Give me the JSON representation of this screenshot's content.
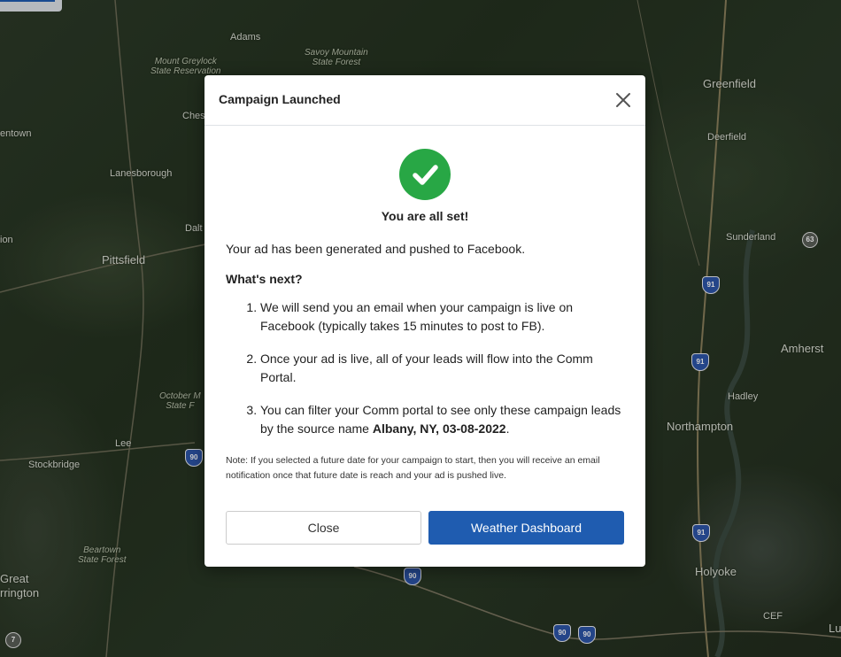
{
  "map": {
    "places": [
      {
        "id": "adams",
        "label": "Adams"
      },
      {
        "id": "mt-greylock",
        "label": "Mount Greylock\nState Reservation"
      },
      {
        "id": "savoy",
        "label": "Savoy Mountain\nState Forest"
      },
      {
        "id": "greenfield",
        "label": "Greenfield"
      },
      {
        "id": "entown",
        "label": "entown"
      },
      {
        "id": "ches",
        "label": "Ches"
      },
      {
        "id": "deerfield",
        "label": "Deerfield"
      },
      {
        "id": "lanesborough",
        "label": "Lanesborough"
      },
      {
        "id": "dalt",
        "label": "Dalt"
      },
      {
        "id": "sunderland",
        "label": "Sunderland"
      },
      {
        "id": "ion",
        "label": "ion"
      },
      {
        "id": "pittsfield",
        "label": "Pittsfield"
      },
      {
        "id": "amherst",
        "label": "Amherst"
      },
      {
        "id": "october",
        "label": "October M\nState F"
      },
      {
        "id": "hadley",
        "label": "Hadley"
      },
      {
        "id": "northampton",
        "label": "Northampton"
      },
      {
        "id": "lee",
        "label": "Lee"
      },
      {
        "id": "stockbridge",
        "label": "Stockbridge"
      },
      {
        "id": "beartown",
        "label": "Beartown\nState Forest"
      },
      {
        "id": "holyoke",
        "label": "Holyoke"
      },
      {
        "id": "great",
        "label": "Great"
      },
      {
        "id": "barrington",
        "label": "rrington"
      },
      {
        "id": "cef",
        "label": "CEF"
      },
      {
        "id": "lu",
        "label": "Lu"
      }
    ],
    "shields": [
      "91",
      "91",
      "91",
      "90",
      "90",
      "90",
      "90"
    ],
    "routes": [
      "63",
      "7"
    ]
  },
  "modal": {
    "title": "Campaign Launched",
    "success_heading": "You are all set!",
    "intro": "Your ad has been generated and pushed to Facebook.",
    "next_heading": "What's next?",
    "steps": [
      "We will send you an email when your campaign is live on Facebook (typically takes 15 minutes to post to FB).",
      "Once your ad is live, all of your leads will flow into the Comm Portal."
    ],
    "step3_prefix": "You can filter your Comm portal to see only these campaign leads by the source name ",
    "step3_source": "Albany, NY, 03-08-2022",
    "step3_suffix": ".",
    "note": "Note: If you selected a future date for your campaign to start, then you will receive an email notification once that future date is reach and your ad is pushed live.",
    "close_label": "Close",
    "primary_label": "Weather Dashboard"
  },
  "colors": {
    "primary": "#1f5cb0",
    "success": "#28a745"
  }
}
